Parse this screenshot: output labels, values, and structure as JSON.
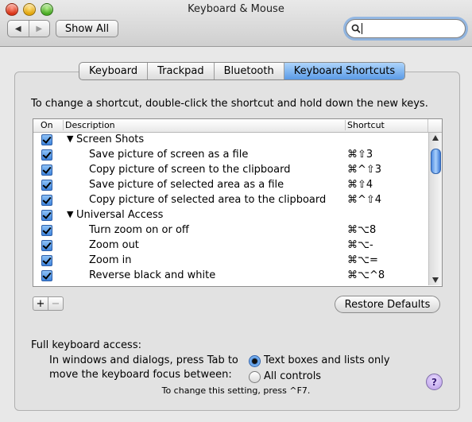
{
  "window": {
    "title": "Keyboard & Mouse"
  },
  "toolbar": {
    "show_all": "Show All",
    "back_icon": "back-arrow-icon",
    "forward_icon": "forward-arrow-icon",
    "search_value": ""
  },
  "tabs": [
    {
      "label": "Keyboard",
      "active": false
    },
    {
      "label": "Trackpad",
      "active": false
    },
    {
      "label": "Bluetooth",
      "active": false
    },
    {
      "label": "Keyboard Shortcuts",
      "active": true
    }
  ],
  "instruction": "To change a shortcut, double-click the shortcut and hold down the new keys.",
  "table": {
    "headers": {
      "on": "On",
      "description": "Description",
      "shortcut": "Shortcut"
    },
    "rows": [
      {
        "type": "group",
        "on": true,
        "description": "Screen Shots",
        "shortcut": ""
      },
      {
        "type": "item",
        "on": true,
        "description": "Save picture of screen as a file",
        "shortcut": "⌘⇧3"
      },
      {
        "type": "item",
        "on": true,
        "description": "Copy picture of screen to the clipboard",
        "shortcut": "⌘^⇧3"
      },
      {
        "type": "item",
        "on": true,
        "description": "Save picture of selected area as a file",
        "shortcut": "⌘⇧4"
      },
      {
        "type": "item",
        "on": true,
        "description": "Copy picture of selected area to the clipboard",
        "shortcut": "⌘^⇧4"
      },
      {
        "type": "group",
        "on": true,
        "description": "Universal Access",
        "shortcut": ""
      },
      {
        "type": "item",
        "on": true,
        "description": "Turn zoom on or off",
        "shortcut": "⌘⌥8"
      },
      {
        "type": "item",
        "on": true,
        "description": "Zoom out",
        "shortcut": "⌘⌥-"
      },
      {
        "type": "item",
        "on": true,
        "description": "Zoom in",
        "shortcut": "⌘⌥="
      },
      {
        "type": "item",
        "on": true,
        "description": "Reverse black and white",
        "shortcut": "⌘⌥^8"
      }
    ]
  },
  "buttons": {
    "add": "+",
    "remove": "−",
    "restore_defaults": "Restore Defaults"
  },
  "full_keyboard_access": {
    "label": "Full keyboard access:",
    "description_line1": "In windows and dialogs, press Tab to",
    "description_line2": "move the keyboard focus between:",
    "options": [
      {
        "label": "Text boxes and lists only",
        "selected": true
      },
      {
        "label": "All controls",
        "selected": false
      }
    ],
    "hint": "To change this setting, press ^F7."
  },
  "help": "?"
}
